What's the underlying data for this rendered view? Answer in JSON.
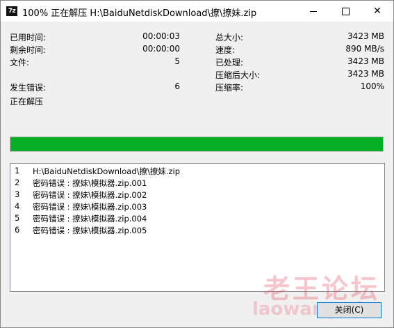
{
  "window": {
    "icon_label": "7z",
    "title": "100% 正在解压 H:\\BaiduNetdiskDownload\\撩\\撩妹.zip",
    "minimize_icon": "minimize-icon",
    "maximize_icon": "maximize-icon",
    "close_icon": "close-icon",
    "close_glyph": "✕"
  },
  "stats_left": [
    {
      "label": "已用时间:",
      "value": "00:00:03"
    },
    {
      "label": "剩余时间:",
      "value": "00:00:00"
    },
    {
      "label": "文件:",
      "value": "5"
    },
    {
      "label": "发生错误:",
      "value": "6"
    }
  ],
  "stats_right": [
    {
      "label": "总大小:",
      "value": "3423 MB"
    },
    {
      "label": "速度:",
      "value": "890 MB/s"
    },
    {
      "label": "已处理:",
      "value": "3423 MB"
    },
    {
      "label": "压缩后大小:",
      "value": "3423 MB"
    },
    {
      "label": "压缩率:",
      "value": "100%"
    }
  ],
  "status_text": "正在解压",
  "progress": {
    "percent": 100,
    "color": "#06b025"
  },
  "messages": [
    {
      "num": "1",
      "text": "H:\\BaiduNetdiskDownload\\撩\\撩妹.zip"
    },
    {
      "num": "2",
      "text": "密码错误 : 撩妹\\模拟器.zip.001"
    },
    {
      "num": "3",
      "text": "密码错误 : 撩妹\\模拟器.zip.002"
    },
    {
      "num": "4",
      "text": "密码错误 : 撩妹\\模拟器.zip.003"
    },
    {
      "num": "5",
      "text": "密码错误 : 撩妹\\模拟器.zip.004"
    },
    {
      "num": "6",
      "text": "密码错误 : 撩妹\\模拟器.zip.005"
    }
  ],
  "close_button": "关闭(C)",
  "watermark": {
    "title": "老王论坛",
    "sub": "laowang.vip"
  }
}
